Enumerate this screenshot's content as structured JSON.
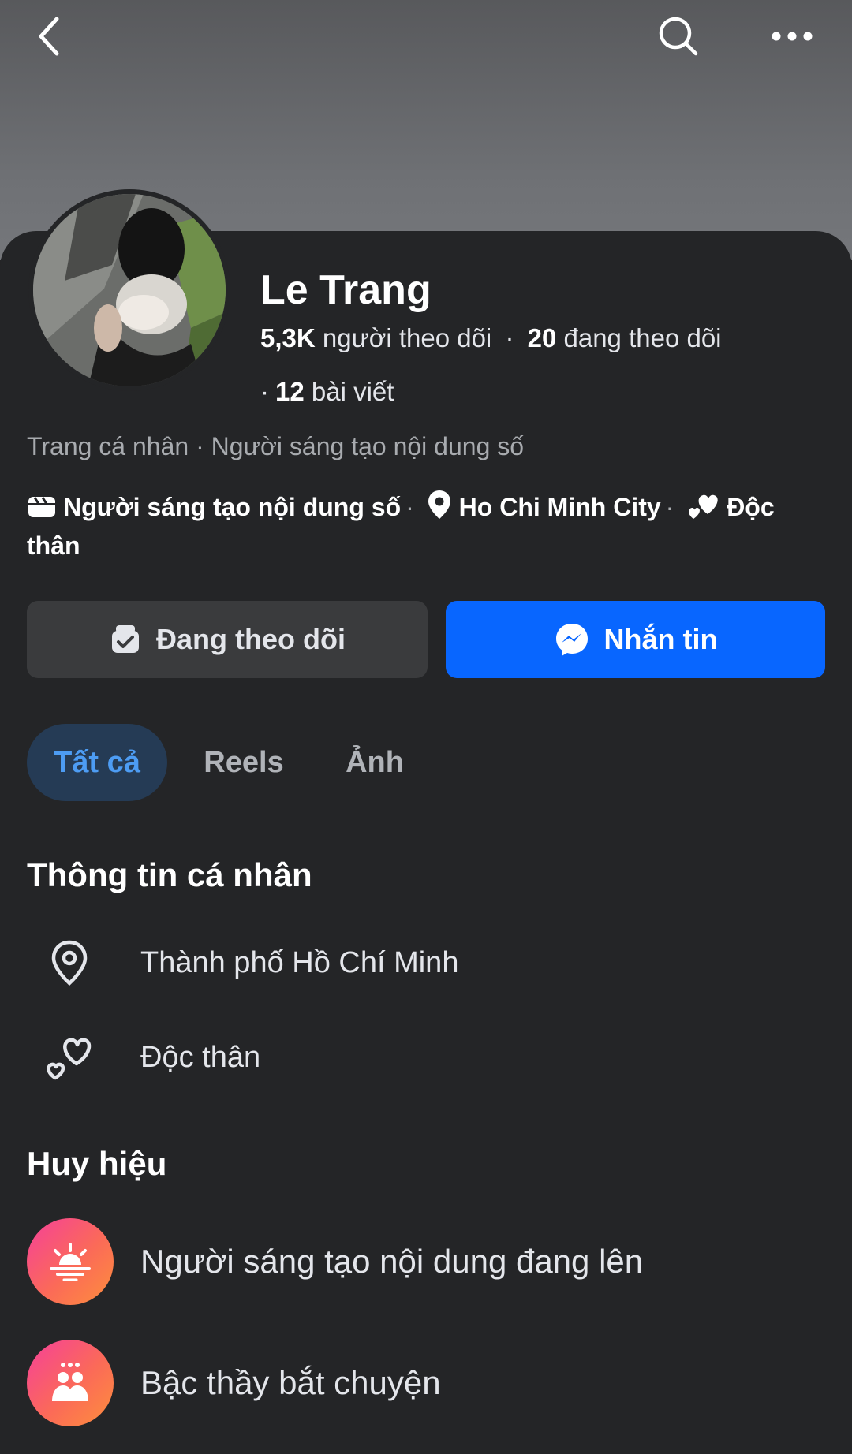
{
  "header": {
    "back_icon": "chevron-left-icon",
    "search_icon": "search-icon",
    "more_icon": "more-horizontal-icon"
  },
  "profile": {
    "name": "Le Trang",
    "followers_count": "5,3K",
    "followers_label": "người theo dõi",
    "following_count": "20",
    "following_label": "đang theo dõi",
    "posts_count": "12",
    "posts_label": "bài viết",
    "category": "Trang cá nhân · Người sáng tạo nội dung số",
    "details": {
      "creator": "Người sáng tạo nội dung số",
      "city": "Ho Chi Minh City",
      "relationship": "Độc thân"
    }
  },
  "actions": {
    "following_label": "Đang theo dõi",
    "message_label": "Nhắn tin"
  },
  "tabs": [
    {
      "label": "Tất cả",
      "active": true
    },
    {
      "label": "Reels",
      "active": false
    },
    {
      "label": "Ảnh",
      "active": false
    }
  ],
  "personal_info": {
    "title": "Thông tin cá nhân",
    "items": [
      {
        "icon": "location-pin-icon",
        "text": "Thành phố Hồ Chí Minh"
      },
      {
        "icon": "hearts-icon",
        "text": "Độc thân"
      }
    ]
  },
  "badges": {
    "title": "Huy hiệu",
    "items": [
      {
        "icon": "sunrise-icon",
        "text": "Người sáng tạo nội dung đang lên"
      },
      {
        "icon": "people-chat-icon",
        "text": "Bậc thầy bắt chuyện"
      }
    ]
  },
  "colors": {
    "background": "#242527",
    "primary_button": "#0866ff",
    "secondary_button": "#3a3b3d",
    "active_tab_bg": "#253b55",
    "active_tab_text": "#4d9cf3",
    "badge_gradient_start": "#f5409a",
    "badge_gradient_end": "#fd8f3c"
  }
}
